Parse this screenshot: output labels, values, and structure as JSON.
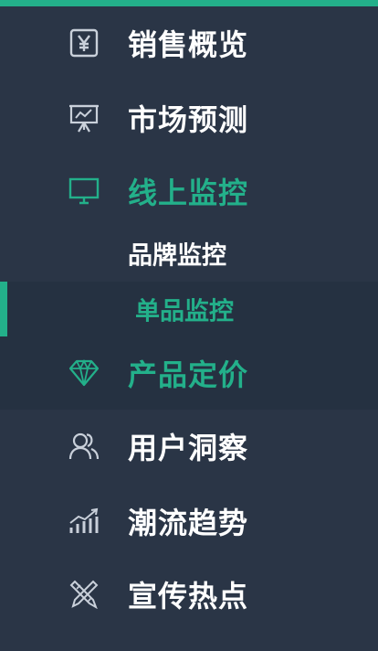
{
  "colors": {
    "accent": "#23b08a",
    "background": "#2a3546",
    "selected_bg": "#253141",
    "text": "#ffffff"
  },
  "menu": {
    "items": [
      {
        "label": "销售概览",
        "icon": "yen-icon"
      },
      {
        "label": "市场预测",
        "icon": "presentation-icon"
      },
      {
        "label": "线上监控",
        "icon": "monitor-icon",
        "expanded": true,
        "children": [
          {
            "label": "品牌监控"
          },
          {
            "label": "单品监控",
            "selected": true
          }
        ]
      },
      {
        "label": "产品定价",
        "icon": "diamond-icon"
      },
      {
        "label": "用户洞察",
        "icon": "users-icon"
      },
      {
        "label": "潮流趋势",
        "icon": "trend-chart-icon"
      },
      {
        "label": "宣传热点",
        "icon": "tools-icon"
      }
    ]
  }
}
